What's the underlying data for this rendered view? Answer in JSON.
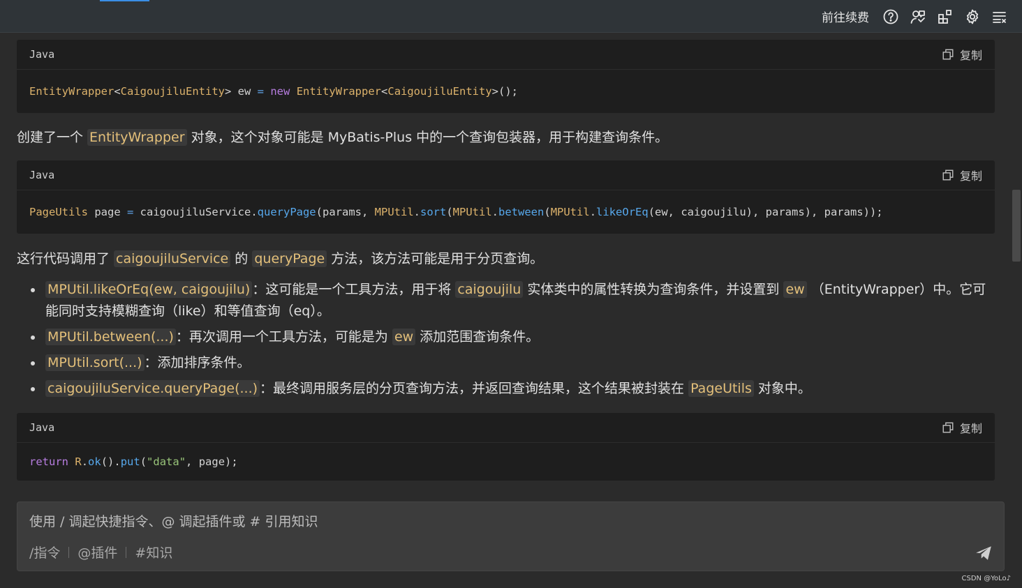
{
  "topbar": {
    "renew_label": "前往续费",
    "icons": [
      "help-icon",
      "feedback-icon",
      "plugins-icon",
      "settings-icon",
      "menu-icon"
    ]
  },
  "blocks": [
    {
      "lang": "Java",
      "copy_label": "复制"
    },
    {
      "lang": "Java",
      "copy_label": "复制"
    },
    {
      "lang": "Java",
      "copy_label": "复制"
    }
  ],
  "code1": {
    "t1": "EntityWrapper",
    "t2": "<",
    "t3": "CaigoujiluEntity",
    "t4": ">",
    "t5": " ew ",
    "t6": "=",
    "t7": " ",
    "t8": "new",
    "t9": " ",
    "t10": "EntityWrapper",
    "t11": "<",
    "t12": "CaigoujiluEntity",
    "t13": ">",
    "t14": "();"
  },
  "para1": {
    "a": "创建了一个 ",
    "code": "EntityWrapper",
    "b": " 对象，这个对象可能是 MyBatis-Plus 中的一个查询包装器，用于构建查询条件。"
  },
  "code2": {
    "t1": "PageUtils",
    "t2": " page ",
    "t3": "=",
    "t4": " caigoujiluService.",
    "t5": "queryPage",
    "t6": "(params, ",
    "t7": "MPUtil",
    "t8": ".",
    "t9": "sort",
    "t10": "(",
    "t11": "MPUtil",
    "t12": ".",
    "t13": "between",
    "t14": "(",
    "t15": "MPUtil",
    "t16": ".",
    "t17": "likeOrEq",
    "t18": "(ew, caigoujilu), params), params));"
  },
  "para2": {
    "a": "这行代码调用了 ",
    "code1": "caigoujiluService",
    "b": " 的 ",
    "code2": "queryPage",
    "c": " 方法，该方法可能是用于分页查询。"
  },
  "bullets": [
    {
      "code": "MPUtil.likeOrEq(ew, caigoujilu)",
      "a": "：这可能是一个工具方法，用于将 ",
      "code2": "caigoujilu",
      "b": " 实体类中的属性转换为查询条件，并设置到 ",
      "code3": "ew",
      "c": " （EntityWrapper）中。它可能同时支持模糊查询（like）和等值查询（eq）。"
    },
    {
      "code": "MPUtil.between(...)",
      "a": "：再次调用一个工具方法，可能是为 ",
      "code2": "ew",
      "b": " 添加范围查询条件。"
    },
    {
      "code": "MPUtil.sort(...)",
      "a": "：添加排序条件。"
    },
    {
      "code": "caigoujiluService.queryPage(...)",
      "a": "：最终调用服务层的分页查询方法，并返回查询结果，这个结果被封装在 ",
      "code2": "PageUtils",
      "b": " 对象中。"
    }
  ],
  "code3": {
    "t1": "return",
    "t2": " ",
    "t3": "R",
    "t4": ".",
    "t5": "ok",
    "t6": "().",
    "t7": "put",
    "t8": "(",
    "t9": "\"data\"",
    "t10": ", page);"
  },
  "input": {
    "placeholder": "使用 / 调起快捷指令、@ 调起插件或 # 引用知识",
    "shortcut_command": "/指令",
    "shortcut_plugin": "@插件",
    "shortcut_knowledge": "#知识"
  },
  "watermark": "CSDN @YoLo♪"
}
